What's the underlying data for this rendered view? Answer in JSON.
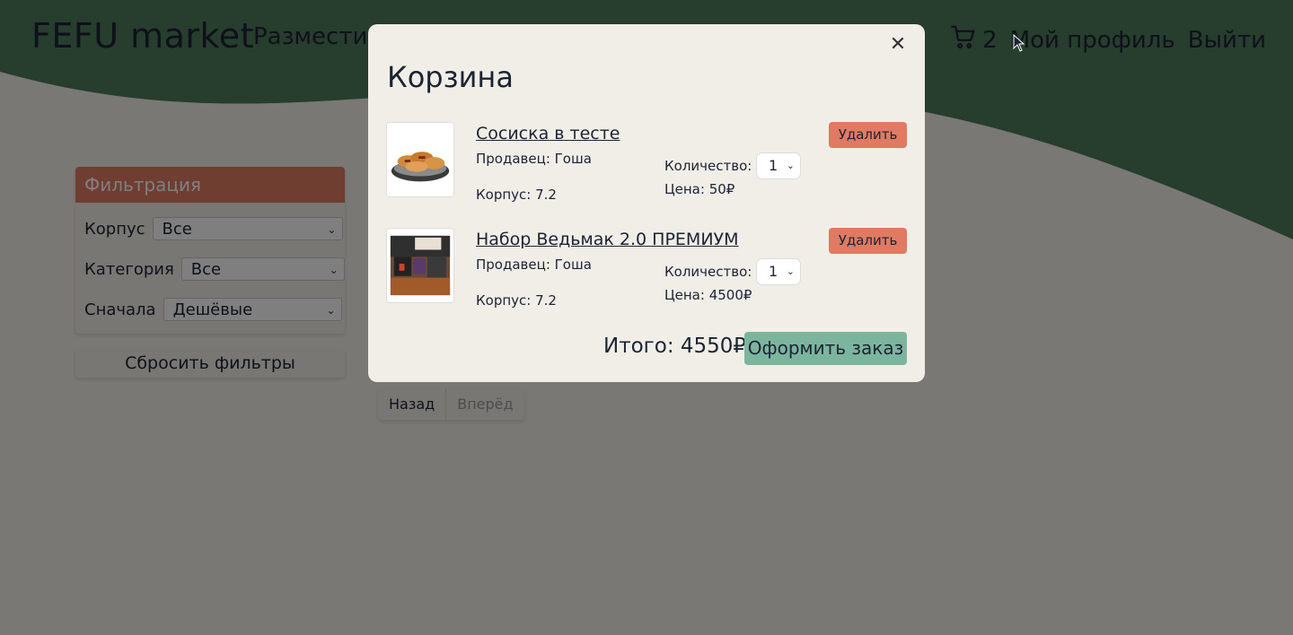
{
  "header": {
    "logo": "FEFU market",
    "nav_place": "Разместить",
    "cart_count": "2",
    "profile": "Мой профиль",
    "logout": "Выйти"
  },
  "filters": {
    "title": "Фильтрация",
    "building_label": "Корпус",
    "building_value": "Все",
    "category_label": "Категория",
    "category_value": "Все",
    "sort_label": "Сначала",
    "sort_value": "Дешёвые",
    "reset": "Сбросить фильтры"
  },
  "pager": {
    "prev": "Назад",
    "next": "Вперёд"
  },
  "cart": {
    "title": "Корзина",
    "items": [
      {
        "name": "Сосиска в тесте",
        "seller": "Продавец: Гоша",
        "building": "Корпус: 7.2",
        "qty_label": "Количество:",
        "qty": "1",
        "price": "Цена: 50₽",
        "delete": "Удалить"
      },
      {
        "name": "Набор Ведьмак 2.0 ПРЕМИУМ",
        "seller": "Продавец: Гоша",
        "building": "Корпус: 7.2",
        "qty_label": "Количество:",
        "qty": "1",
        "price": "Цена: 4500₽",
        "delete": "Удалить"
      }
    ],
    "total": "Итого: 4550₽",
    "checkout": "Оформить заказ"
  },
  "colors": {
    "header_green": "#4f7a5d",
    "accent_red": "#e07a62",
    "accent_green": "#7cb59e",
    "panel": "#f0eee7"
  }
}
